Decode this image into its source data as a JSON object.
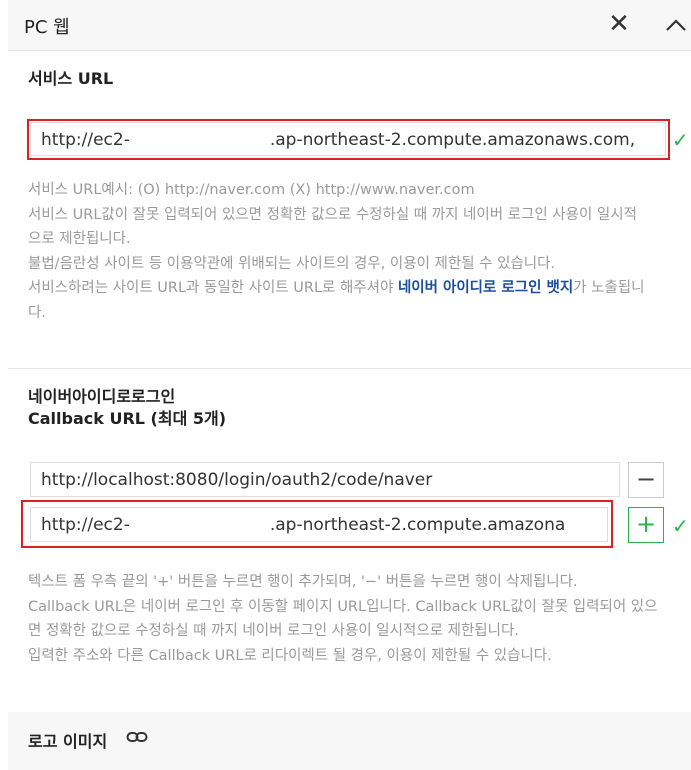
{
  "header": {
    "title": "PC 웹",
    "close_glyph": "✕",
    "collapse_icon": "chevron-up-icon"
  },
  "service_url": {
    "title": "서비스 URL",
    "value_prefix": "http://ec2-",
    "value_suffix": ".ap-northeast-2.compute.amazonaws.com,",
    "help": [
      "서비스 URL예시: (O) http://naver.com (X) http://www.naver.com",
      "서비스 URL값이 잘못 입력되어 있으면 정확한 값으로 수정하실 때 까지 네이버 로그인 사용이 일시적으로 제한됩니다.",
      "불법/음란성 사이트 등 이용약관에 위배되는 사이트의 경우, 이용이 제한될 수 있습니다."
    ],
    "help_last_pre": "서비스하려는 사이트 URL과 동일한 사이트 URL로 해주셔야 ",
    "help_last_link": "네이버 아이디로 로그인 뱃지",
    "help_last_post": "가 노출됩니다."
  },
  "callback": {
    "title_line1": "네이버아이디로로그인",
    "title_line2": "Callback URL (최대 5개)",
    "url1": "http://localhost:8080/login/oauth2/code/naver",
    "url2_prefix": "http://ec2-",
    "url2_suffix": ".ap-northeast-2.compute.amazona",
    "minus_label": "−",
    "plus_label": "+",
    "help": [
      "텍스트 폼 우측 끝의 '+' 버튼을 누르면 행이 추가되며, '−' 버튼을 누르면 행이 삭제됩니다.",
      "Callback URL은 네이버 로그인 후 이동할 페이지 URL입니다. Callback URL값이 잘못 입력되어 있으면 정확한 값으로 수정하실 때 까지 네이버 로그인 사용이 일시적으로 제한됩니다.",
      "입력한 주소와 다른 Callback URL로 리다이렉트 될 경우, 이용이 제한될 수 있습니다."
    ]
  },
  "logo": {
    "title": "로고 이미지",
    "icon": "link-icon"
  },
  "colors": {
    "highlight": "#e02020",
    "check": "#2bb24c",
    "link": "#1c4d9c"
  }
}
